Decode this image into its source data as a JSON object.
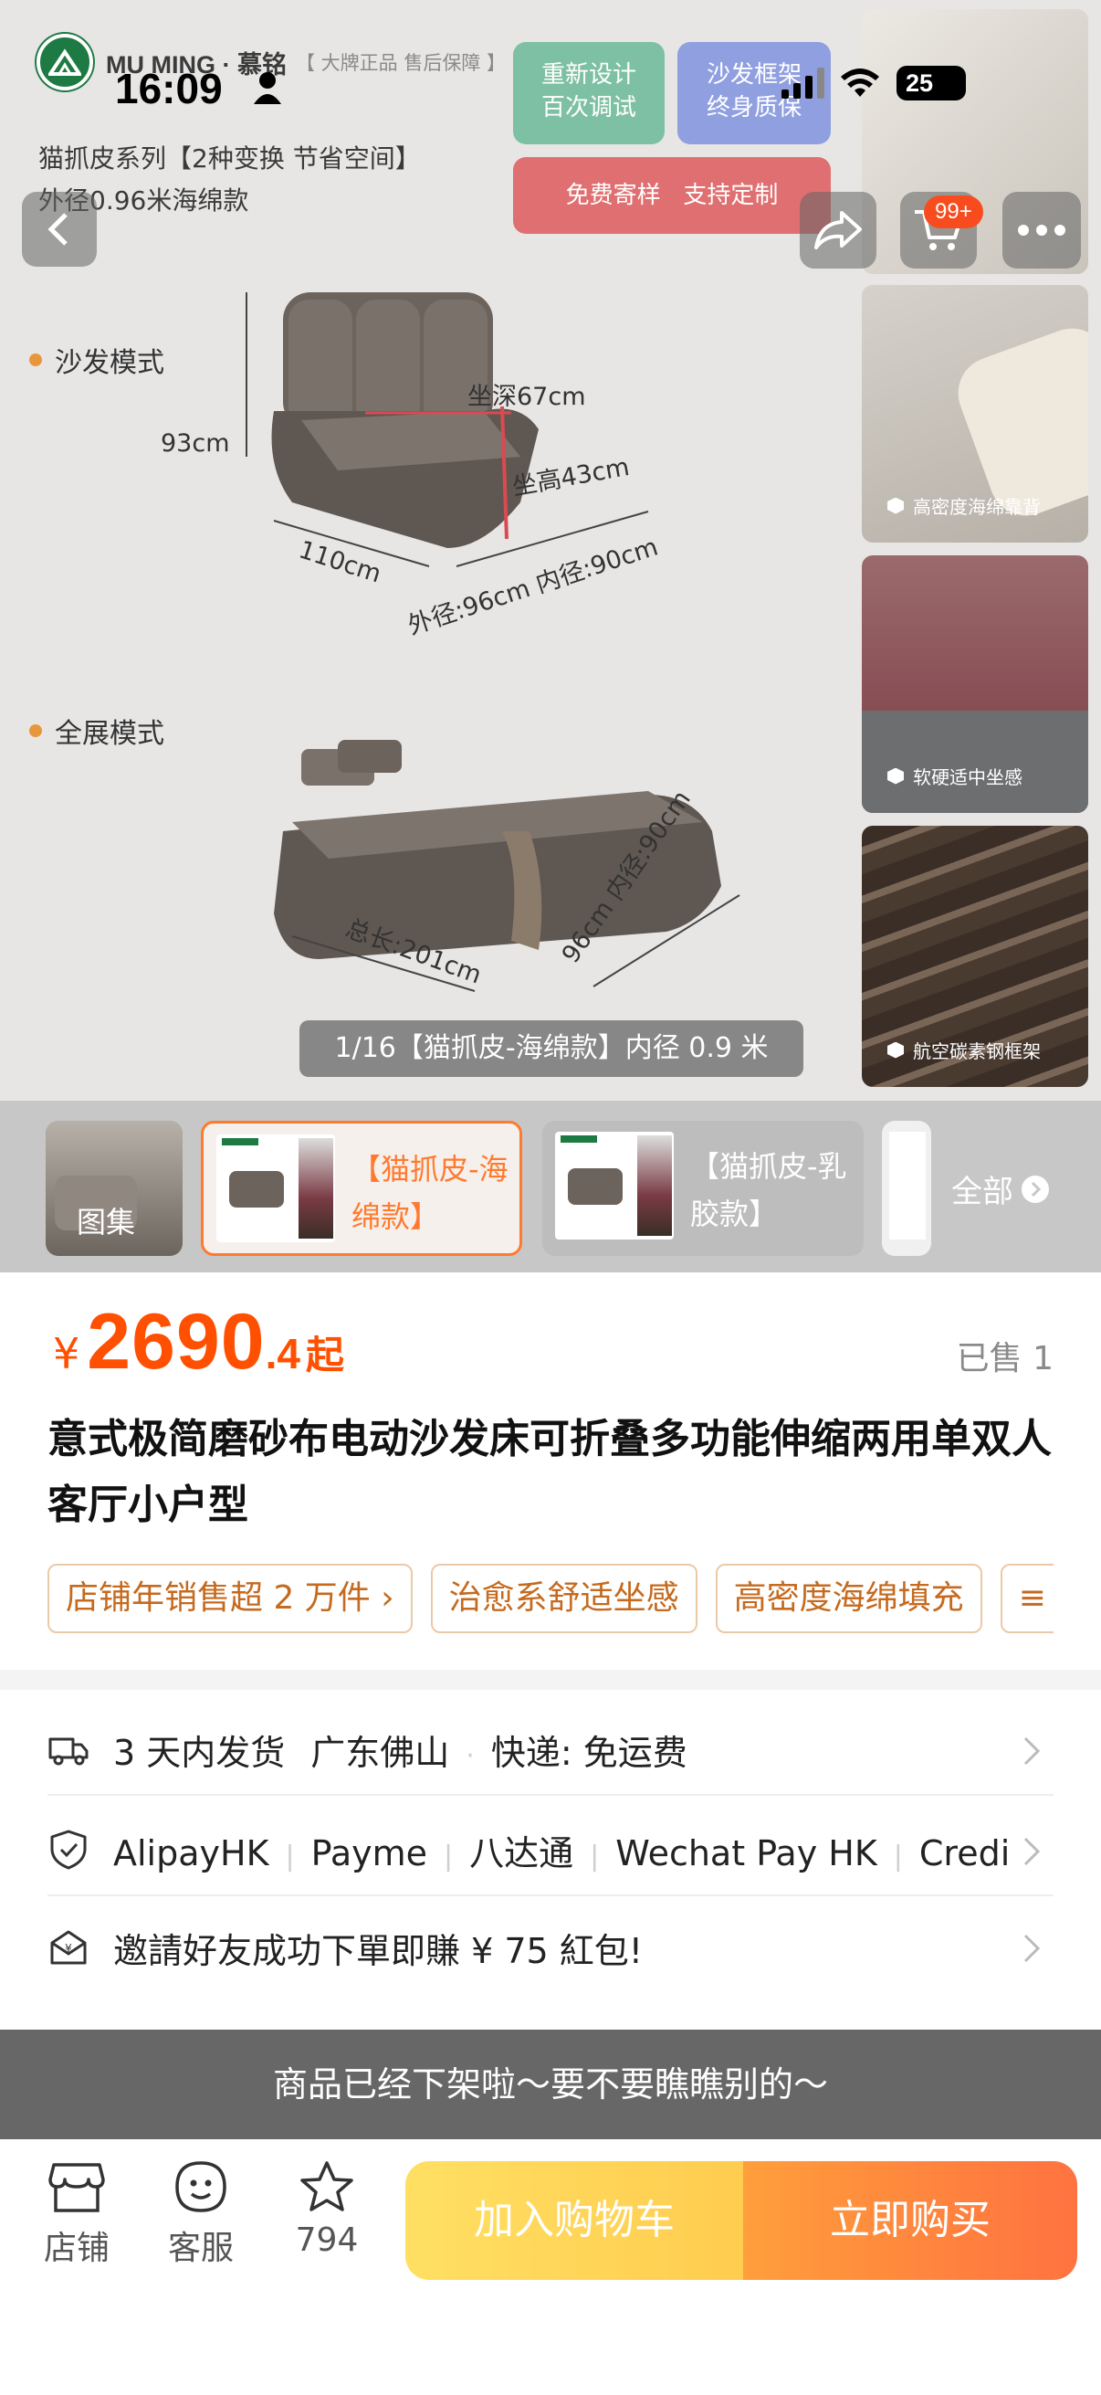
{
  "status_bar": {
    "time": "16:09",
    "battery": "25"
  },
  "hero": {
    "brand_name": "MU MING · 慕铭",
    "brand_slogan": "【 大牌正品 售后保障 】",
    "series_title": "猫抓皮系列【2种变换 节省空间】",
    "series_subtitle": "外径0.96米海绵款",
    "tag_redesign": "重新设计\n百次调试",
    "tag_frame": "沙发框架\n终身质保",
    "tag_sample": "免费寄样   支持定制",
    "sofa_mode": "沙发模式",
    "full_mode": "全展模式",
    "dim_height": "93cm",
    "dim_seat_depth": "坐深67cm",
    "dim_seat_height": "坐高43cm",
    "dim_width": "110cm",
    "dim_outer": "外径:96cm 内径:90cm",
    "dim_total": "总长:201cm",
    "dim_outer2": "96cm 内径:90cm",
    "thumb_captions": [
      "高密度海绵靠背",
      "软硬适中坐感",
      "航空碳素钢框架"
    ],
    "image_counter": "1/16【猫抓皮-海绵款】内径 0.9 米",
    "cart_badge": "99+"
  },
  "variants": {
    "gallery_label": "图集",
    "items": [
      {
        "label": "【猫抓皮-海绵款】",
        "selected": true
      },
      {
        "label": "【猫抓皮-乳胶款】",
        "selected": false
      }
    ],
    "all_label": "全部"
  },
  "product": {
    "currency": "¥",
    "price_int": "2690",
    "price_dec": ".4",
    "price_suffix": "起",
    "sold": "已售 1",
    "title": "意式极简磨砂布电动沙发床可折叠多功能伸缩两用单双人客厅小户型",
    "chips": [
      "店铺年销售超 2 万件 ›",
      "治愈系舒适坐感",
      "高密度海绵填充",
      "≡"
    ]
  },
  "info_rows": {
    "shipping": {
      "ship_time": "3 天内发货",
      "origin": "广东佛山",
      "express": "快递:  免运费"
    },
    "payment": {
      "methods": [
        "AlipayHK",
        "Payme",
        "八达通",
        "Wechat Pay HK",
        "Credit"
      ]
    },
    "invite": {
      "text": "邀請好友成功下單即賺 ¥ 75 紅包!"
    }
  },
  "toast": "商品已经下架啦～要不要瞧瞧别的～",
  "bottom_bar": {
    "shop": "店铺",
    "service": "客服",
    "favorite_count": "794",
    "add_to_cart": "加入购物车",
    "buy_now": "立即购买"
  },
  "colors": {
    "accent": "#ff4f00",
    "chip_border": "#ecc9a6",
    "chip_text": "#c56a1e",
    "selected_variant": "#ff7a2f"
  }
}
